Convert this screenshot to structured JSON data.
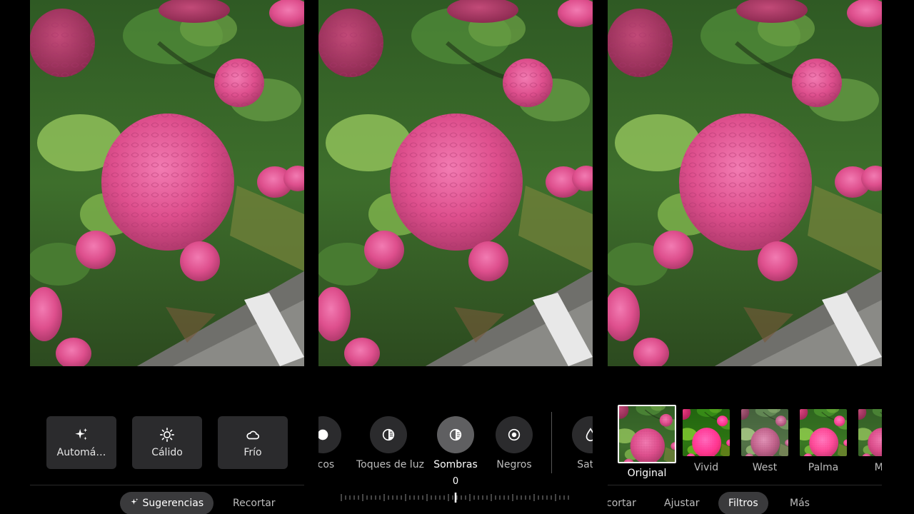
{
  "panel1": {
    "suggestions": [
      {
        "label": "Automá…",
        "icon": "sparkle-icon"
      },
      {
        "label": "Cálido",
        "icon": "sun-icon"
      },
      {
        "label": "Frío",
        "icon": "cloud-icon"
      }
    ],
    "tabs": [
      {
        "label": "Sugerencias",
        "active": true,
        "icon": "sparkle-icon"
      },
      {
        "label": "Recortar",
        "active": false
      }
    ]
  },
  "panel2": {
    "adjustments": [
      {
        "label": "ncos",
        "icon": "half-circle-icon"
      },
      {
        "label": "Toques de luz",
        "icon": "highlights-icon"
      },
      {
        "label": "Sombras",
        "icon": "shadows-icon",
        "active": true
      },
      {
        "label": "Negros",
        "icon": "target-icon"
      },
      {
        "label": "Satur",
        "icon": "saturation-icon"
      }
    ],
    "slider_value": "0"
  },
  "panel3": {
    "filters": [
      {
        "label": "Original",
        "active": true
      },
      {
        "label": "Vivid"
      },
      {
        "label": "West"
      },
      {
        "label": "Palma"
      },
      {
        "label": "Me"
      }
    ],
    "tabs": [
      {
        "label": "cortar"
      },
      {
        "label": "Ajustar"
      },
      {
        "label": "Filtros",
        "active": true
      },
      {
        "label": "Más"
      }
    ]
  },
  "colors": {
    "background": "#000000",
    "card": "#2b2b2d",
    "active_chip": "#3a3a3c",
    "flower_pink": "#e05a95"
  }
}
